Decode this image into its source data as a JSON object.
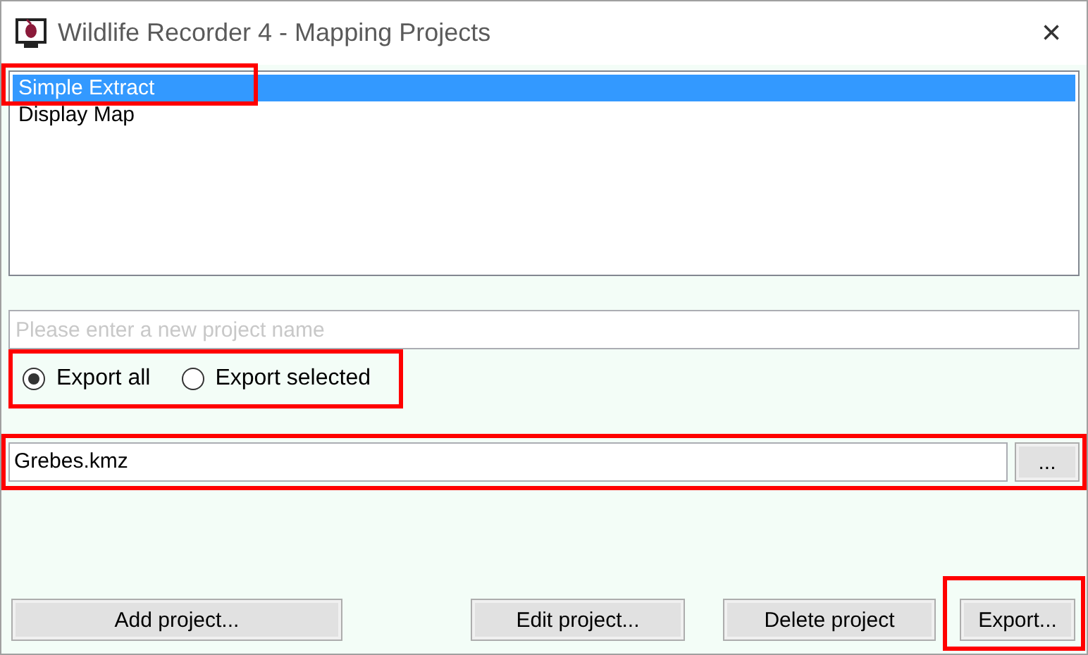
{
  "window": {
    "title": "Wildlife Recorder 4 - Mapping Projects",
    "close": "×"
  },
  "projects": [
    {
      "label": "Simple Extract",
      "selected": true,
      "highlighted": true
    },
    {
      "label": "Display Map",
      "selected": false,
      "highlighted": false
    }
  ],
  "project_name": {
    "placeholder": "Please enter a new project name"
  },
  "export_options": {
    "highlighted": true,
    "options": [
      {
        "label": "Export all",
        "selected": true
      },
      {
        "label": "Export selected",
        "selected": false
      }
    ]
  },
  "file": {
    "value": "Grebes.kmz",
    "browse_label": "...",
    "highlighted": true
  },
  "buttons": [
    {
      "label": "Add project...",
      "highlighted": false
    },
    {
      "label": "Edit project...",
      "highlighted": false
    },
    {
      "label": "Delete project",
      "highlighted": false
    },
    {
      "label": "Export...",
      "highlighted": true
    }
  ]
}
